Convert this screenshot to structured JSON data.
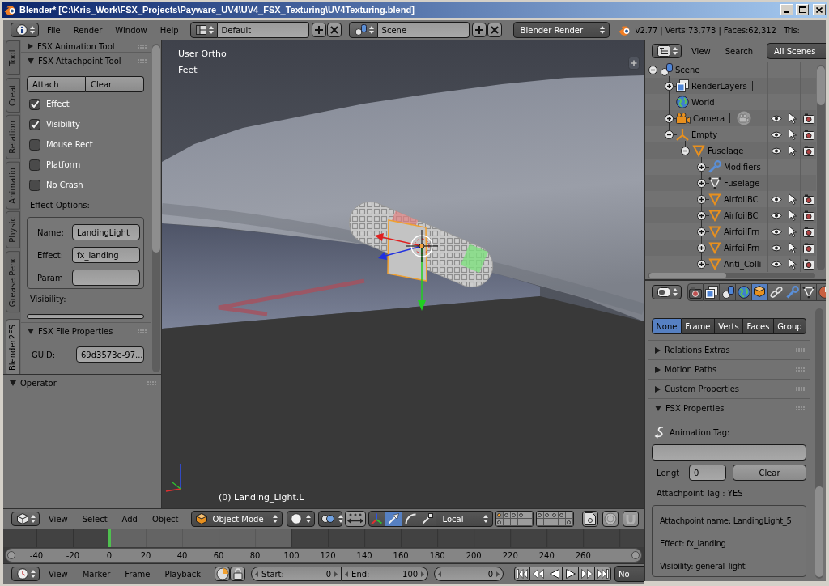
{
  "window": {
    "title": "Blender* [C:\\Kris_Work\\FSX_Projects\\Payware_UV4\\UV4_FSX_Texturing\\UV4Texturing.blend]"
  },
  "info_header": {
    "menus": [
      "File",
      "Render",
      "Window",
      "Help"
    ],
    "screen_layout": "Default",
    "scene": "Scene",
    "render_engine": "Blender Render",
    "stats": "v2.77 | Verts:73,773 | Faces:62,312 | Tris:"
  },
  "tool_shelf": {
    "tabs": [
      {
        "label": "Tool",
        "selected": false
      },
      {
        "label": "Creat",
        "selected": false
      },
      {
        "label": "Relation",
        "selected": false
      },
      {
        "label": "Animatio",
        "selected": false
      },
      {
        "label": "Physic",
        "selected": false
      },
      {
        "label": "Grease Penc",
        "selected": false
      },
      {
        "label": "Blender2FS",
        "selected": true
      }
    ],
    "animation_panel": {
      "title": "FSX Animation Tool",
      "expanded": false
    },
    "attachpoint_panel": {
      "title": "FSX Attachpoint Tool",
      "expanded": true,
      "buttons": [
        "Attach",
        "Clear"
      ],
      "checkboxes": [
        {
          "label": "Effect",
          "checked": true
        },
        {
          "label": "Visibility",
          "checked": true
        },
        {
          "label": "Mouse Rect",
          "checked": false
        },
        {
          "label": "Platform",
          "checked": false
        },
        {
          "label": "No Crash",
          "checked": false
        }
      ],
      "effect_options_label": "Effect Options:",
      "effect_fields": [
        {
          "label": "Name:",
          "value": "LandingLight"
        },
        {
          "label": "Effect:",
          "value": "fx_landing"
        },
        {
          "label": "Param"
        }
      ],
      "visibility_label": "Visibility:"
    },
    "file_panel": {
      "title": "FSX File Properties",
      "expanded": true,
      "fields": [
        {
          "label": "GUID:",
          "value": "69d3573e-97..."
        }
      ]
    },
    "operator_panel": {
      "title": "Operator",
      "expanded": true
    }
  },
  "viewport": {
    "view_name": "User Ortho",
    "units": "Feet",
    "object_info": "(0) Landing_Light.L"
  },
  "viewport_header": {
    "menus": [
      "View",
      "Select",
      "Add",
      "Object"
    ],
    "mode": "Object Mode",
    "manipulators": [
      {
        "kind": "translate",
        "selected": true
      },
      {
        "kind": "rotate",
        "selected": false
      },
      {
        "kind": "scale",
        "selected": false
      }
    ],
    "orientation": "Local",
    "layers": [
      {
        "selected": true,
        "used": true,
        "active_object": true
      },
      {
        "selected": false,
        "used": true,
        "active_object": false
      },
      {
        "selected": false,
        "used": true,
        "active_object": false
      },
      {
        "selected": false,
        "used": true,
        "active_object": false
      },
      {
        "selected": false,
        "used": false,
        "active_object": false
      },
      {
        "selected": false,
        "used": true,
        "active_object": false
      },
      {
        "selected": false,
        "used": true,
        "active_object": false
      },
      {
        "selected": false,
        "used": true,
        "active_object": false
      },
      {
        "selected": false,
        "used": true,
        "active_object": false
      },
      {
        "selected": false,
        "used": false,
        "active_object": false
      },
      {
        "selected": false,
        "used": true,
        "active_object": false
      },
      {
        "selected": false,
        "used": false,
        "active_object": false
      },
      {
        "selected": false,
        "used": false,
        "active_object": false
      },
      {
        "selected": false,
        "used": false,
        "active_object": false
      },
      {
        "selected": false,
        "used": false,
        "active_object": false
      },
      {
        "selected": false,
        "used": false,
        "active_object": false
      },
      {
        "selected": false,
        "used": false,
        "active_object": false
      },
      {
        "selected": false,
        "used": false,
        "active_object": false
      },
      {
        "selected": false,
        "used": false,
        "active_object": false
      },
      {
        "selected": false,
        "used": true,
        "active_object": false
      }
    ]
  },
  "timeline": {
    "ticks": [
      "-40",
      "-20",
      "0",
      "20",
      "40",
      "60",
      "80",
      "100",
      "120",
      "140",
      "160",
      "180",
      "200",
      "220",
      "240",
      "260"
    ]
  },
  "timeline_header": {
    "menus": [
      "View",
      "Marker",
      "Frame",
      "Playback"
    ],
    "start_label": "Start:",
    "start": "0",
    "end_label": "End:",
    "end": "100",
    "current_frame": "0",
    "keying_set": "No"
  },
  "outliner": {
    "menus": [
      "View",
      "Search"
    ],
    "display_mode": "All Scenes",
    "tree": [
      {
        "name": "Scene",
        "kind": "scene",
        "expanded": true,
        "children": [
          {
            "name": "RenderLayers",
            "kind": "render_layers",
            "expanded": false
          },
          {
            "name": "World",
            "kind": "world"
          },
          {
            "name": "Camera",
            "kind": "camera",
            "expanded": false,
            "restrict": {
              "visible": true,
              "selectable": true,
              "renderable": true
            }
          },
          {
            "name": "Empty",
            "kind": "empty",
            "expanded": true,
            "restrict": {
              "visible": true,
              "selectable": true,
              "renderable": true
            },
            "children": [
              {
                "name": "Fuselage",
                "kind": "mesh",
                "expanded": true,
                "restrict": {
                  "visible": true,
                  "selectable": true,
                  "renderable": true
                },
                "children": [
                  {
                    "name": "Modifiers",
                    "kind": "modifiers",
                    "expanded": false
                  },
                  {
                    "name": "Fuselage",
                    "kind": "mesh_data",
                    "expanded": false
                  },
                  {
                    "name": "AirfoilBC",
                    "kind": "mesh",
                    "expanded": false,
                    "restrict": {
                      "visible": true,
                      "selectable": true,
                      "renderable": true
                    }
                  },
                  {
                    "name": "AirfoilBC",
                    "kind": "mesh",
                    "expanded": false,
                    "restrict": {
                      "visible": true,
                      "selectable": true,
                      "renderable": true
                    }
                  },
                  {
                    "name": "AirfoilFrn",
                    "kind": "mesh",
                    "expanded": false,
                    "restrict": {
                      "visible": true,
                      "selectable": true,
                      "renderable": true
                    }
                  },
                  {
                    "name": "AirfoilFrn",
                    "kind": "mesh",
                    "expanded": false,
                    "restrict": {
                      "visible": true,
                      "selectable": true,
                      "renderable": true
                    }
                  },
                  {
                    "name": "Anti_Colli",
                    "kind": "mesh",
                    "expanded": false,
                    "restrict": {
                      "visible": true,
                      "selectable": true,
                      "renderable": true
                    }
                  }
                ]
              }
            ]
          }
        ]
      }
    ]
  },
  "properties": {
    "tabs": [
      {
        "kind": "render",
        "selected": false
      },
      {
        "kind": "render_layers",
        "selected": false
      },
      {
        "kind": "scene",
        "selected": false
      },
      {
        "kind": "world",
        "selected": false
      },
      {
        "kind": "object",
        "selected": true
      },
      {
        "kind": "constraints",
        "selected": false
      },
      {
        "kind": "modifiers",
        "selected": false
      },
      {
        "kind": "data",
        "selected": false
      },
      {
        "kind": "material",
        "selected": false
      }
    ],
    "segments": [
      {
        "label": "None",
        "selected": true
      },
      {
        "label": "Frame",
        "selected": false
      },
      {
        "label": "Verts",
        "selected": false
      },
      {
        "label": "Faces",
        "selected": false
      },
      {
        "label": "Group",
        "selected": false
      }
    ],
    "panels": [
      {
        "title": "Relations Extras",
        "expanded": false
      },
      {
        "title": "Motion Paths",
        "expanded": false
      },
      {
        "title": "Custom Properties",
        "expanded": false
      },
      {
        "title": "FSX Properties",
        "expanded": true,
        "body": {
          "animation_tag_label": "Animation Tag:",
          "length_label": "Lengt",
          "length": "0",
          "clear_button": "Clear",
          "attachpoint_tag": "Attachpoint Tag : YES",
          "details": [
            "Attachpoint name: LandingLight_5",
            "Effect: fx_landing",
            "Visibility: general_light"
          ]
        }
      }
    ]
  }
}
